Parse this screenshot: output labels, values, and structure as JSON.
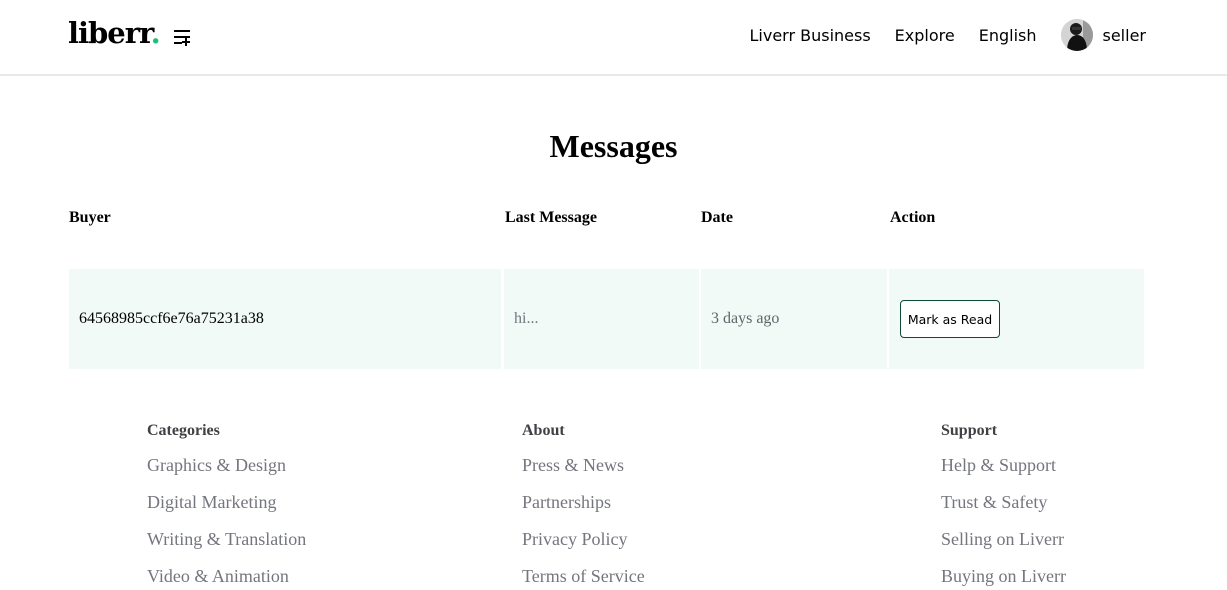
{
  "navbar": {
    "logo_text": "liberr",
    "logo_dot": ".",
    "links": [
      "Liverr Business",
      "Explore",
      "English"
    ],
    "user_name": "seller",
    "accent_color": "#1dbf73"
  },
  "page": {
    "title": "Messages"
  },
  "table": {
    "headers": [
      "Buyer",
      "Last Message",
      "Date",
      "Action"
    ],
    "rows": [
      {
        "buyer": "64568985ccf6e76a75231a38",
        "last_message": "hi...",
        "date": "3 days ago",
        "action_label": "Mark as Read"
      }
    ]
  },
  "footer": {
    "columns": [
      {
        "heading": "Categories",
        "links": [
          "Graphics & Design",
          "Digital Marketing",
          "Writing & Translation",
          "Video & Animation"
        ]
      },
      {
        "heading": "About",
        "links": [
          "Press & News",
          "Partnerships",
          "Privacy Policy",
          "Terms of Service"
        ]
      },
      {
        "heading": "Support",
        "links": [
          "Help & Support",
          "Trust & Safety",
          "Selling on Liverr",
          "Buying on Liverr"
        ]
      }
    ]
  },
  "icons": {
    "menu": "menu-icon",
    "avatar": "avatar"
  }
}
